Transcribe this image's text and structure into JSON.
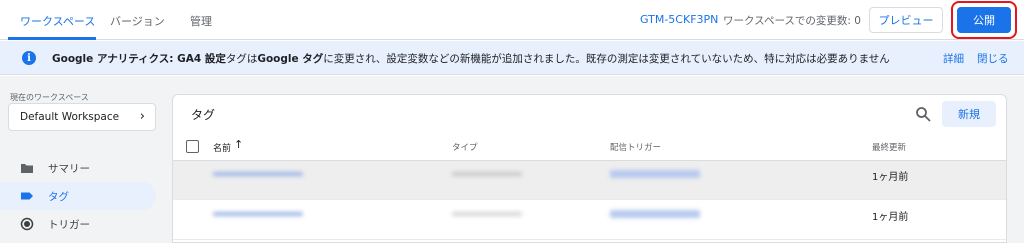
{
  "topbar": {
    "tabs": [
      {
        "label": "ワークスペース",
        "active": true
      },
      {
        "label": "バージョン",
        "active": false
      },
      {
        "label": "管理",
        "active": false
      }
    ],
    "container_id": "GTM-5CKF3PN",
    "changes_text": "ワークスペースでの変更数: 0",
    "preview_label": "プレビュー",
    "publish_label": "公開"
  },
  "banner": {
    "icon": "info-icon",
    "text_bold_1": "Google アナリティクス: GA4 設定",
    "text_1": "タグは",
    "text_bold_2": "Google タグ",
    "text_2": "に変更され、設定変数などの新機能が追加されました。既存の測定は変更されていないため、特に対応は必要ありません",
    "details_label": "詳細",
    "close_label": "閉じる"
  },
  "sidebar": {
    "workspace_caption": "現在のワークスペース",
    "workspace_name": "Default Workspace",
    "items": [
      {
        "label": "サマリー",
        "icon": "folder-icon",
        "active": false
      },
      {
        "label": "タグ",
        "icon": "tag-icon",
        "active": true
      },
      {
        "label": "トリガー",
        "icon": "trigger-icon",
        "active": false
      }
    ]
  },
  "tags_card": {
    "title": "タグ",
    "new_label": "新規",
    "columns": [
      "名前",
      "タイプ",
      "配信トリガー",
      "最終更新"
    ],
    "sort_indicator": "↑",
    "rows": [
      {
        "updated": "1ヶ月前"
      },
      {
        "updated": "1ヶ月前"
      }
    ]
  },
  "colors": {
    "accent": "#1a73e8",
    "highlight": "#e8141b",
    "banner_bg": "#e8f0fe"
  }
}
